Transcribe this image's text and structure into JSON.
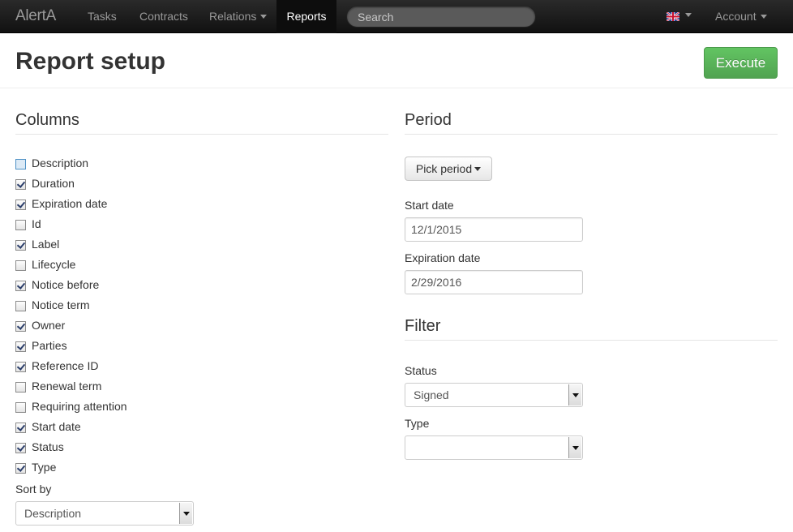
{
  "navbar": {
    "brand": "AlertA",
    "items": [
      {
        "label": "Tasks",
        "active": false
      },
      {
        "label": "Contracts",
        "active": false
      },
      {
        "label": "Relations",
        "active": false,
        "dropdown": true
      },
      {
        "label": "Reports",
        "active": true
      }
    ],
    "search_placeholder": "Search",
    "language_icon": "uk-flag-icon",
    "account_label": "Account"
  },
  "header": {
    "title": "Report setup",
    "execute_label": "Execute"
  },
  "columns": {
    "title": "Columns",
    "items": [
      {
        "label": "Description",
        "checked": false
      },
      {
        "label": "Duration",
        "checked": true
      },
      {
        "label": "Expiration date",
        "checked": true
      },
      {
        "label": "Id",
        "checked": false
      },
      {
        "label": "Label",
        "checked": true
      },
      {
        "label": "Lifecycle",
        "checked": false
      },
      {
        "label": "Notice before",
        "checked": true
      },
      {
        "label": "Notice term",
        "checked": false
      },
      {
        "label": "Owner",
        "checked": true
      },
      {
        "label": "Parties",
        "checked": true
      },
      {
        "label": "Reference ID",
        "checked": true
      },
      {
        "label": "Renewal term",
        "checked": false
      },
      {
        "label": "Requiring attention",
        "checked": false
      },
      {
        "label": "Start date",
        "checked": true
      },
      {
        "label": "Status",
        "checked": true
      },
      {
        "label": "Type",
        "checked": true
      }
    ],
    "sort_by_label": "Sort by",
    "sort_by_value": "Description"
  },
  "period": {
    "title": "Period",
    "pick_label": "Pick period",
    "start_label": "Start date",
    "start_value": "12/1/2015",
    "expiration_label": "Expiration date",
    "expiration_value": "2/29/2016"
  },
  "filter": {
    "title": "Filter",
    "status_label": "Status",
    "status_value": "Signed",
    "type_label": "Type",
    "type_value": ""
  },
  "colors": {
    "navbar_bg": "#1b1b1b",
    "execute_green": "#5bb75b",
    "checkbox_focus": "#4f91c5"
  }
}
